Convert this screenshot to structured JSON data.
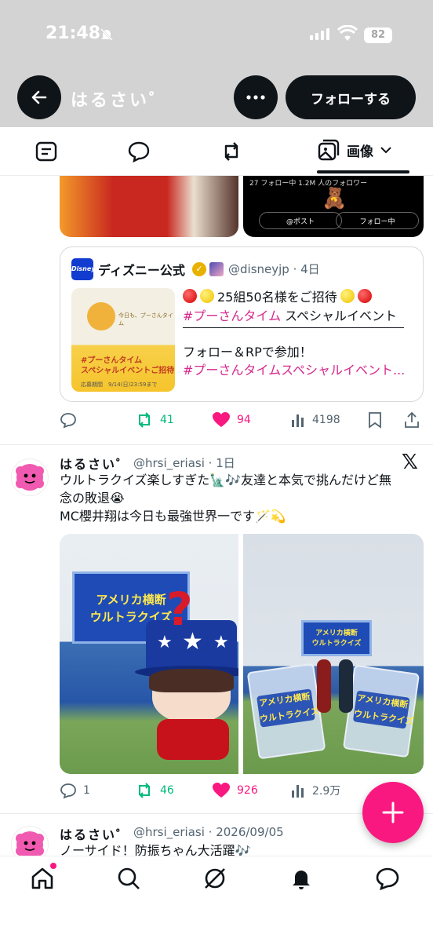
{
  "status_bar": {
    "time": "21:48",
    "battery": "82"
  },
  "header": {
    "title": "はるさい",
    "title_mark": "゜",
    "follow_label": "フォローする"
  },
  "tabs": {
    "image_label": "画像"
  },
  "prev_media": {
    "followers_line": "27 フォロー中  1.2M 人のフォロワー",
    "post_button": "@ポスト",
    "following_button": "フォロー中"
  },
  "quote": {
    "avatar_text": "Disney",
    "name": "ディズニー公式",
    "handle_time": "@disneyjp · 4日",
    "line1": "25組50名様をご招待",
    "line2_tag": "#プーさんタイム",
    "line2_rest": " スペシャルイベント",
    "line3": "フォロー＆RPで参加！",
    "line4": "#プーさんタイムスペシャルイベント...",
    "thumb_caption": "今日も、プーさんタイム",
    "thumb_banner": "#プーさんタイム\nスペシャルイベントご招待",
    "thumb_foot": "応募期間　9/14(日)23:59まで"
  },
  "tweet0_actions": {
    "reply": "",
    "retweet": "41",
    "like": "94",
    "views": "4198"
  },
  "tweet1": {
    "name": "はるさい",
    "name_mark": "゜",
    "handle_time": "@hrsi_eriasi · 1日",
    "line1": "ウルトラクイズ楽しすぎた🗽🎶友達と本気で挑んだけど無",
    "line2": "念の敗退😭",
    "line3": "MC櫻井翔は今日も最強世界一です🪄💫",
    "actions": {
      "reply": "1",
      "retweet": "46",
      "like": "926",
      "views": "2.9万"
    }
  },
  "photos": {
    "stage_title": "アメリカ横断\nウルトラクイズ",
    "card_title": "アメリカ横断\nウルトラクイズ"
  },
  "tweet2": {
    "name": "はるさい",
    "name_mark": "゜",
    "handle_time": "@hrsi_eriasi · 2026/09/05",
    "line1": "ノーサイド！防振ちゃん大活躍🎶"
  },
  "colors": {
    "accent_pink": "#f91880",
    "retweet_green": "#00ba7c",
    "hashtag_pink": "#d6278d",
    "header_gray": "#d3d3d3"
  }
}
